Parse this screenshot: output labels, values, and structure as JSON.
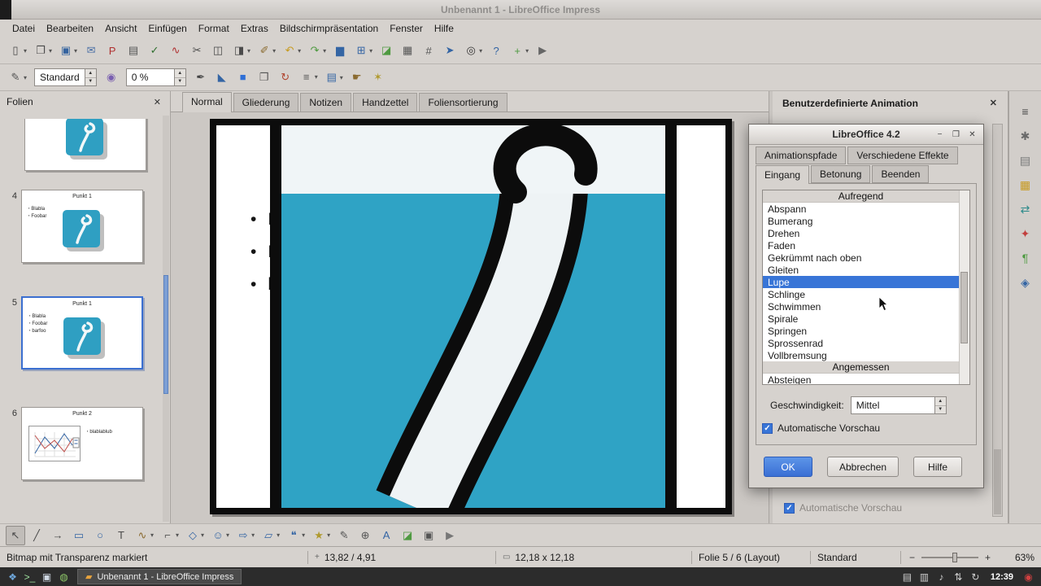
{
  "window": {
    "title": "Unbenannt 1 - LibreOffice Impress"
  },
  "menubar": {
    "items": [
      "Datei",
      "Bearbeiten",
      "Ansicht",
      "Einfügen",
      "Format",
      "Extras",
      "Bildschirmpräsentation",
      "Fenster",
      "Hilfe"
    ]
  },
  "toolbars": {
    "style_value": "Standard",
    "transparency_value": "0 %",
    "standard": [
      {
        "name": "new-document-icon",
        "glyph": "▯",
        "dd": true
      },
      {
        "name": "open-document-icon",
        "glyph": "❐",
        "dd": true
      },
      {
        "name": "save-icon",
        "glyph": "▣",
        "color": "#35639f",
        "dd": true
      },
      {
        "name": "email-icon",
        "glyph": "✉",
        "color": "#4a6fa5"
      },
      {
        "name": "export-pdf-icon",
        "glyph": "P",
        "color": "#b03030"
      },
      {
        "name": "print-icon",
        "glyph": "▤",
        "color": "#555555"
      },
      {
        "name": "spellcheck-icon",
        "glyph": "✓",
        "color": "#2f6f2f"
      },
      {
        "name": "auto-spellcheck-icon",
        "glyph": "∿",
        "color": "#b03030"
      },
      {
        "name": "cut-icon",
        "glyph": "✂"
      },
      {
        "name": "copy-icon",
        "glyph": "◫"
      },
      {
        "name": "paste-icon",
        "glyph": "◨",
        "dd": true
      },
      {
        "name": "clone-formatting-icon",
        "glyph": "✐",
        "color": "#8a6a2f",
        "dd": true
      },
      {
        "name": "undo-icon",
        "glyph": "↶",
        "color": "#c79a1e",
        "dd": true
      },
      {
        "name": "redo-icon",
        "glyph": "↷",
        "color": "#4e9a40",
        "dd": true
      },
      {
        "name": "chart-icon",
        "glyph": "▆",
        "color": "#3465a4"
      },
      {
        "name": "table-icon",
        "glyph": "⊞",
        "color": "#3465a4",
        "dd": true
      },
      {
        "name": "image-icon",
        "glyph": "◪",
        "color": "#4e9a40"
      },
      {
        "name": "grid-icon",
        "glyph": "▦",
        "color": "#555555"
      },
      {
        "name": "snap-lines-icon",
        "glyph": "#",
        "color": "#555555"
      },
      {
        "name": "navigator-icon",
        "glyph": "➤",
        "color": "#3465a4"
      },
      {
        "name": "zoom-icon",
        "glyph": "◎",
        "color": "#333333",
        "dd": true
      },
      {
        "name": "help-icon",
        "glyph": "?",
        "color": "#3465a4"
      },
      {
        "name": "extension-icon",
        "glyph": "+",
        "color": "#4e9a40",
        "dd": true
      },
      {
        "name": "media-icon",
        "glyph": "▶",
        "color": "#666666"
      }
    ],
    "line_a": [
      {
        "name": "edit-points-icon",
        "glyph": "✎",
        "color": "#555555",
        "dd": true
      }
    ],
    "line_b": [
      {
        "name": "gradient-icon",
        "glyph": "◉",
        "color": "#7a5fb0"
      }
    ],
    "line_c": [
      {
        "name": "line-style-icon",
        "glyph": "✒",
        "color": "#444444"
      },
      {
        "name": "fill-color-icon",
        "glyph": "◣",
        "color": "#3465a4"
      },
      {
        "name": "fill-swatch-icon",
        "glyph": "■",
        "color": "#2f6fd6"
      },
      {
        "name": "shadow-icon",
        "glyph": "❐",
        "color": "#555555"
      },
      {
        "name": "rotate-icon",
        "glyph": "↻",
        "color": "#b0452f"
      },
      {
        "name": "align-icon",
        "glyph": "≡",
        "color": "#555555",
        "dd": true
      },
      {
        "name": "arrange-icon",
        "glyph": "▤",
        "color": "#3465a4",
        "dd": true
      },
      {
        "name": "interaction-icon",
        "glyph": "☛",
        "color": "#8a6a2f"
      },
      {
        "name": "animation-effects-icon",
        "glyph": "✶",
        "color": "#b09a2f"
      }
    ],
    "drawbar": [
      {
        "name": "select-icon",
        "glyph": "↖",
        "selected": true
      },
      {
        "name": "line-icon",
        "glyph": "╱"
      },
      {
        "name": "arrow-icon",
        "glyph": "→"
      },
      {
        "name": "rectangle-icon",
        "glyph": "▭",
        "color": "#3465a4"
      },
      {
        "name": "ellipse-icon",
        "glyph": "○",
        "color": "#3465a4"
      },
      {
        "name": "text-icon",
        "glyph": "T"
      },
      {
        "name": "curve-icon",
        "glyph": "∿",
        "color": "#8a6a2f",
        "dd": true
      },
      {
        "name": "connector-icon",
        "glyph": "⌐",
        "color": "#555555",
        "dd": true
      },
      {
        "name": "basic-shapes-icon",
        "glyph": "◇",
        "color": "#3465a4",
        "dd": true
      },
      {
        "name": "symbol-shapes-icon",
        "glyph": "☺",
        "color": "#3465a4",
        "dd": true
      },
      {
        "name": "block-arrows-icon",
        "glyph": "⇨",
        "color": "#3465a4",
        "dd": true
      },
      {
        "name": "flowchart-icon",
        "glyph": "▱",
        "color": "#3465a4",
        "dd": true
      },
      {
        "name": "callouts-icon",
        "glyph": "❝",
        "color": "#3465a4",
        "dd": true
      },
      {
        "name": "stars-icon",
        "glyph": "★",
        "color": "#b09a2f",
        "dd": true
      },
      {
        "name": "edit-points-tool-icon",
        "glyph": "✎",
        "color": "#555555"
      },
      {
        "name": "glue-points-icon",
        "glyph": "⊕",
        "color": "#555555"
      },
      {
        "name": "fontwork-icon",
        "glyph": "A",
        "color": "#3465a4"
      },
      {
        "name": "insert-image-icon",
        "glyph": "◪",
        "color": "#4e9a40"
      },
      {
        "name": "snapshot-icon",
        "glyph": "▣",
        "color": "#555555"
      },
      {
        "name": "media-playback-icon",
        "glyph": "▶",
        "color": "#777777"
      }
    ]
  },
  "slides_panel": {
    "title": "Folien",
    "slides": [
      {
        "number": "4",
        "title": "Punkt 1",
        "bullets": [
          "Blabla",
          "Foobar"
        ]
      },
      {
        "number": "5",
        "title": "Punkt 1",
        "bullets": [
          "Blabla",
          "Foobar",
          "barfoo"
        ],
        "selected": true
      },
      {
        "number": "6",
        "title": "Punkt 2",
        "bullets": [
          "blablablub"
        ]
      }
    ]
  },
  "view_tabs": {
    "tabs": [
      {
        "label": "Normal",
        "selected": true
      },
      {
        "label": "Gliederung"
      },
      {
        "label": "Notizen"
      },
      {
        "label": "Handzettel"
      },
      {
        "label": "Foliensortierung"
      }
    ]
  },
  "slide_content": {
    "bullets": [
      "Blabla",
      "Foobar",
      "barfoo"
    ]
  },
  "sidebar": {
    "title": "Benutzerdefinierte Animation",
    "auto_preview_label": "Automatische Vorschau",
    "decks": [
      {
        "name": "sidebar-menu-icon",
        "glyph": "≡",
        "color": "#444444"
      },
      {
        "name": "properties-icon",
        "glyph": "✱",
        "color": "#6a6a6a"
      },
      {
        "name": "master-pages-icon",
        "glyph": "▤",
        "color": "#777777"
      },
      {
        "name": "gallery-icon",
        "glyph": "▦",
        "color": "#c89a20"
      },
      {
        "name": "slide-transition-icon",
        "glyph": "⇄",
        "color": "#2e8b8b"
      },
      {
        "name": "custom-animation-icon",
        "glyph": "✦",
        "color": "#c2403e"
      },
      {
        "name": "styles-icon",
        "glyph": "¶",
        "color": "#4e9a40"
      },
      {
        "name": "navigator-deck-icon",
        "glyph": "◈",
        "color": "#3465a4"
      }
    ]
  },
  "dialog": {
    "title": "LibreOffice 4.2",
    "tabs_top": [
      {
        "label": "Animationspfade"
      },
      {
        "label": "Verschiedene Effekte"
      }
    ],
    "tabs_main": [
      {
        "label": "Eingang",
        "selected": true
      },
      {
        "label": "Betonung"
      },
      {
        "label": "Beenden"
      }
    ],
    "effects": [
      {
        "type": "header",
        "name": "effect-category",
        "label": "Aufregend"
      },
      {
        "label": "Abspann"
      },
      {
        "label": "Bumerang"
      },
      {
        "label": "Drehen"
      },
      {
        "label": "Faden"
      },
      {
        "label": "Gekrümmt nach oben"
      },
      {
        "label": "Gleiten"
      },
      {
        "label": "Lupe",
        "selected": true
      },
      {
        "label": "Schlinge"
      },
      {
        "label": "Schwimmen"
      },
      {
        "label": "Spirale"
      },
      {
        "label": "Springen"
      },
      {
        "label": "Sprossenrad"
      },
      {
        "label": "Vollbremsung"
      },
      {
        "type": "header",
        "name": "effect-category",
        "label": "Angemessen"
      },
      {
        "label": "Absteigen"
      }
    ],
    "speed_label": "Geschwindigkeit:",
    "speed_value": "Mittel",
    "auto_preview_label": "Automatische Vorschau",
    "buttons": [
      {
        "label": "OK",
        "name": "ok-button",
        "type": "primary"
      },
      {
        "label": "Abbrechen",
        "name": "cancel-button"
      },
      {
        "label": "Hilfe",
        "name": "help-button"
      }
    ]
  },
  "statusbar": {
    "message": "Bitmap mit Transparenz markiert",
    "position": "13,82 / 4,91",
    "size": "12,18 x 12,18",
    "slide_info": "Folie 5 / 6 (Layout)",
    "template_name": "Standard",
    "zoom_percent": "63%"
  },
  "taskbar": {
    "launchers": [
      {
        "name": "applications-menu-icon",
        "glyph": "❖",
        "color": "#6fa8dc"
      },
      {
        "name": "terminal-icon",
        "glyph": ">_",
        "color": "#9fe29f"
      },
      {
        "name": "file-manager-icon",
        "glyph": "▣",
        "color": "#cfd8e3"
      },
      {
        "name": "browser-icon",
        "glyph": "◍",
        "color": "#8fc96a"
      }
    ],
    "task_label": "Unbenannt 1 - LibreOffice Impress",
    "tray": [
      {
        "name": "clipboard-tray-icon",
        "glyph": "▤"
      },
      {
        "name": "keyboard-layout-icon",
        "glyph": "▥"
      },
      {
        "name": "volume-icon",
        "glyph": "♪"
      },
      {
        "name": "network-icon",
        "glyph": "⇅"
      },
      {
        "name": "update-icon",
        "glyph": "↻"
      }
    ],
    "clock": "12:39",
    "power": {
      "name": "power-icon",
      "glyph": "◉",
      "color": "#d04040"
    }
  }
}
